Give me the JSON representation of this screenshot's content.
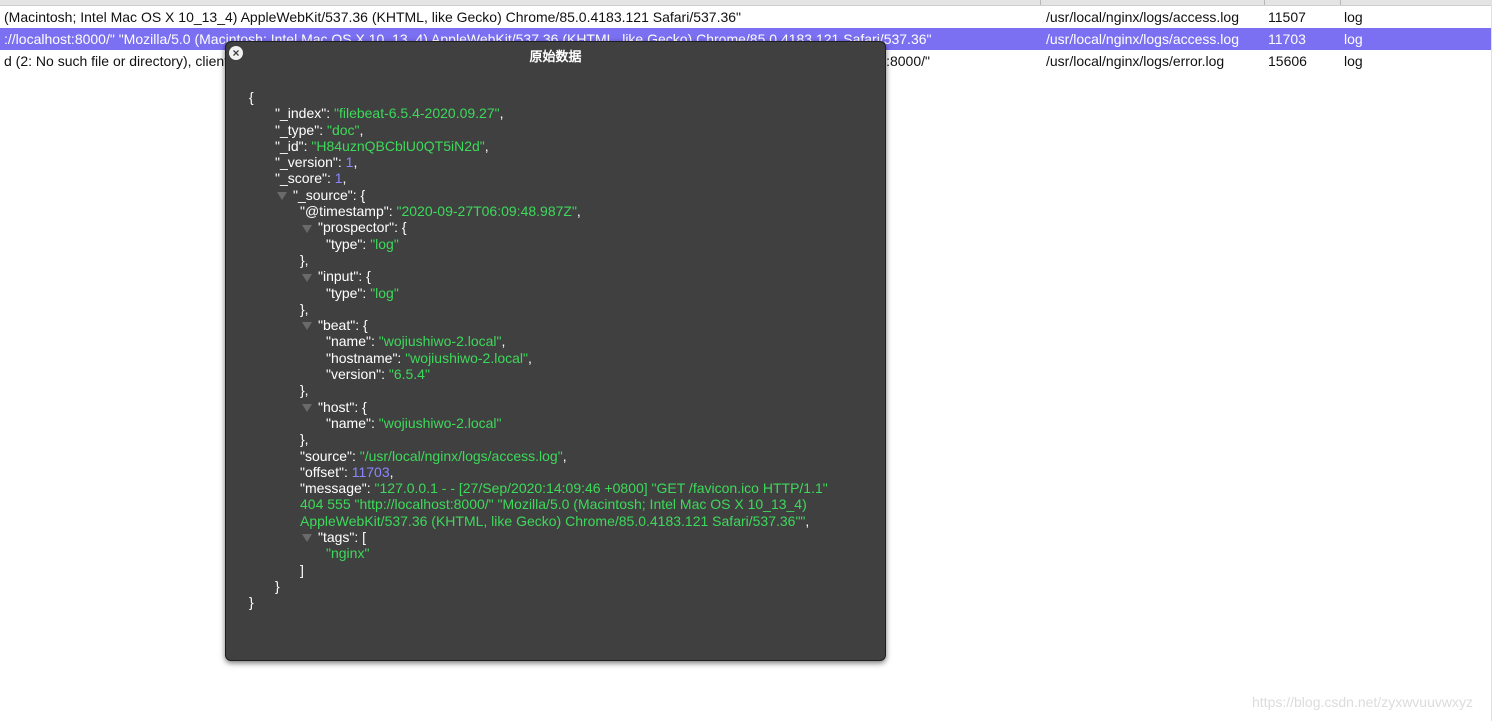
{
  "table": {
    "rows": [
      {
        "message": "(Macintosh; Intel Mac OS X 10_13_4) AppleWebKit/537.36 (KHTML, like Gecko) Chrome/85.0.4183.121 Safari/537.36\"",
        "source": "/usr/local/nginx/logs/access.log",
        "offset": "11507",
        "type": "log"
      },
      {
        "message": "://localhost:8000/\" \"Mozilla/5.0 (Macintosh; Intel Mac OS X 10_13_4) AppleWebKit/537.36 (KHTML, like Gecko) Chrome/85.0.4183.121 Safari/537.36\"",
        "source": "/usr/local/nginx/logs/access.log",
        "offset": "11703",
        "type": "log",
        "selected": true
      },
      {
        "message": "d (2: No such file or directory), client: 127.0.0.1, server: , request: \"GET /favicon.ico HTTP/1.1\", host: \"localhost:8000\", referrer: \"http://localhost:8000/\"",
        "source": "/usr/local/nginx/logs/error.log",
        "offset": "15606",
        "type": "log"
      }
    ]
  },
  "modal": {
    "title": "原始数据",
    "close_icon": "close-circle-icon",
    "json": {
      "_index": "\"filebeat-6.5.4-2020.09.27\"",
      "_type": "\"doc\"",
      "_id": "\"H84uznQBCblU0QT5iN2d\"",
      "_version": "1",
      "_score": "1",
      "source_timestamp": "\"2020-09-27T06:09:48.987Z\"",
      "prospector_type": "\"log\"",
      "input_type": "\"log\"",
      "beat_name": "\"wojiushiwo-2.local\"",
      "beat_hostname": "\"wojiushiwo-2.local\"",
      "beat_version": "\"6.5.4\"",
      "host_name": "\"wojiushiwo-2.local\"",
      "source": "\"/usr/local/nginx/logs/access.log\"",
      "offset": "11703",
      "message": "\"127.0.0.1 - - [27/Sep/2020:14:09:46 +0800] \"GET /favicon.ico HTTP/1.1\" 404 555 \"http://localhost:8000/\" \"Mozilla/5.0 (Macintosh; Intel Mac OS X 10_13_4) AppleWebKit/537.36 (KHTML, like Gecko) Chrome/85.0.4183.121 Safari/537.36\"\"",
      "tag_0": "\"nginx\""
    }
  },
  "watermark": "https://blog.csdn.net/zyxwvuuvwxyz"
}
